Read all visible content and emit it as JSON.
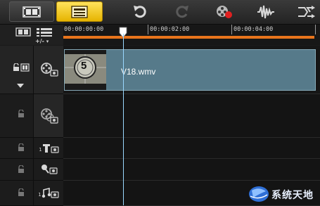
{
  "toolbar": {
    "view_buttons": [
      {
        "name": "storyboard-view",
        "icon": "filmstrip-icon",
        "active": false
      },
      {
        "name": "timeline-view",
        "icon": "timeline-icon",
        "active": true
      }
    ],
    "actions": [
      {
        "name": "undo",
        "icon": "undo-icon"
      },
      {
        "name": "redo",
        "icon": "redo-icon"
      },
      {
        "name": "record-capture",
        "icon": "record-icon"
      },
      {
        "name": "sound-mixer",
        "icon": "audio-wave-icon"
      },
      {
        "name": "auto-music",
        "icon": "auto-music-icon"
      }
    ]
  },
  "ruler": {
    "timecodes": [
      "00:00:00:00",
      "00:00:02:00",
      "00:00:04:00"
    ],
    "add_remove_label": "+/-"
  },
  "tracks": [
    {
      "id": "video",
      "icon": "video-track-icon",
      "clip": "V18.wmv",
      "leader_number": "5"
    },
    {
      "id": "overlay",
      "icon": "overlay-track-icon"
    },
    {
      "id": "title",
      "icon": "title-track-icon",
      "number": "1"
    },
    {
      "id": "voice",
      "icon": "voice-track-icon"
    },
    {
      "id": "music",
      "icon": "music-track-icon",
      "number": "1"
    }
  ],
  "watermark": {
    "text": "系统天地"
  },
  "colors": {
    "accent": "#ffd21f",
    "progress": "#e8741c",
    "clip": "#567a8a",
    "playhead": "#9ad8ff"
  }
}
